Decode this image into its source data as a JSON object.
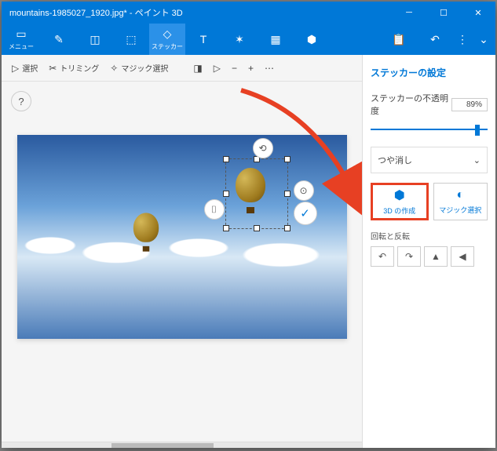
{
  "titlebar": {
    "title": "mountains-1985027_1920.jpg* - ペイント 3D"
  },
  "toolbar": {
    "menu": "メニュー",
    "sticker": "ステッカー"
  },
  "canvasToolbar": {
    "select": "選択",
    "trim": "トリミング",
    "magic": "マジック選択"
  },
  "help": "?",
  "side": {
    "title": "ステッカーの設定",
    "opacity_label": "ステッカーの不透明度",
    "opacity_value": "89%",
    "matte": "つや消し",
    "make3d": "3D の作成",
    "magic": "マジック選択",
    "rot_label": "回転と反転"
  }
}
